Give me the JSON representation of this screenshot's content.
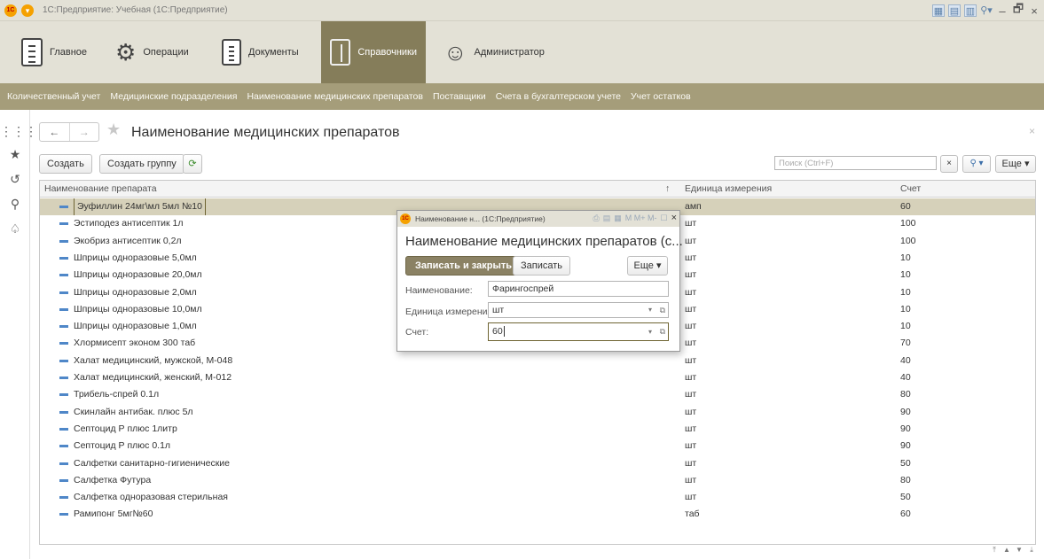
{
  "window": {
    "app_logo": "1С",
    "title": "1С:Предприятие: Учебная (1С:Предприятие)",
    "minimize": "–",
    "restore": "🗗",
    "close": "×"
  },
  "sections": [
    {
      "label": "Главное",
      "icon": "document-list-icon",
      "active": false
    },
    {
      "label": "Операции",
      "icon": "gears-icon",
      "active": false
    },
    {
      "label": "Документы",
      "icon": "documents-icon",
      "active": false
    },
    {
      "label": "Справочники",
      "icon": "binder-icon",
      "active": true
    },
    {
      "label": "Администратор",
      "icon": "admin-icon",
      "active": false
    }
  ],
  "subsections": [
    "Количественный учет",
    "Медицинские подразделения",
    "Наименование медицинских препаратов",
    "Поставщики",
    "Счета в бухгалтерском учете",
    "Учет остатков"
  ],
  "form": {
    "title": "Наименование медицинских препаратов",
    "create_label": "Создать",
    "create_group_label": "Создать группу",
    "search_placeholder": "Поиск (Ctrl+F)",
    "more_label": "Еще ▾",
    "columns": {
      "name": "Наименование препарата",
      "sort": "↑",
      "unit": "Единица измерения",
      "account": "Счет"
    }
  },
  "rows": [
    {
      "name": "Эуфиллин 24мг\\мл 5мл №10",
      "unit": "амп",
      "account": "60",
      "selected": true
    },
    {
      "name": "Эстиподез антисептик 1л",
      "unit": "шт",
      "account": "100"
    },
    {
      "name": "Экобриз антисептик 0,2л",
      "unit": "шт",
      "account": "100"
    },
    {
      "name": "Шприцы одноразовые 5,0мл",
      "unit": "шт",
      "account": "10"
    },
    {
      "name": "Шприцы одноразовые 20,0мл",
      "unit": "шт",
      "account": "10"
    },
    {
      "name": "Шприцы одноразовые 2,0мл",
      "unit": "шт",
      "account": "10"
    },
    {
      "name": "Шприцы одноразовые 10,0мл",
      "unit": "шт",
      "account": "10"
    },
    {
      "name": "Шприцы одноразовые 1,0мл",
      "unit": "шт",
      "account": "10"
    },
    {
      "name": "Хлормисепт эконом 300 таб",
      "unit": "шт",
      "account": "70"
    },
    {
      "name": "Халат медицинский, мужской, М-048",
      "unit": "шт",
      "account": "40"
    },
    {
      "name": "Халат медицинский, женский, М-012",
      "unit": "шт",
      "account": "40"
    },
    {
      "name": "Трибель-спрей 0.1л",
      "unit": "шт",
      "account": "80"
    },
    {
      "name": "Скинлайн антибак. плюс 5л",
      "unit": "шт",
      "account": "90"
    },
    {
      "name": "Септоцид Р плюс 1литр",
      "unit": "шт",
      "account": "90"
    },
    {
      "name": "Септоцид Р плюс 0.1л",
      "unit": "шт",
      "account": "90"
    },
    {
      "name": "Салфетки санитарно-гигиенические",
      "unit": "шт",
      "account": "50"
    },
    {
      "name": "Салфетка Футура",
      "unit": "шт",
      "account": "80"
    },
    {
      "name": "Салфетка одноразовая стерильная",
      "unit": "шт",
      "account": "50"
    },
    {
      "name": "Рамипонг 5мг№60",
      "unit": "таб",
      "account": "60"
    }
  ],
  "dialog": {
    "window_title": "Наименование н... (1С:Предприятие)",
    "toolbar": "M  M+  M-",
    "heading": "Наименование медицинских препаратов (с...",
    "save_close_label": "Записать и закрыть",
    "save_label": "Записать",
    "more_label": "Еще ▾",
    "fields": [
      {
        "label": "Наименование:",
        "value": "Фарингоспрей"
      },
      {
        "label": "Единица измерения:",
        "value": "шт"
      },
      {
        "label": "Счет:",
        "value": "60"
      }
    ]
  }
}
